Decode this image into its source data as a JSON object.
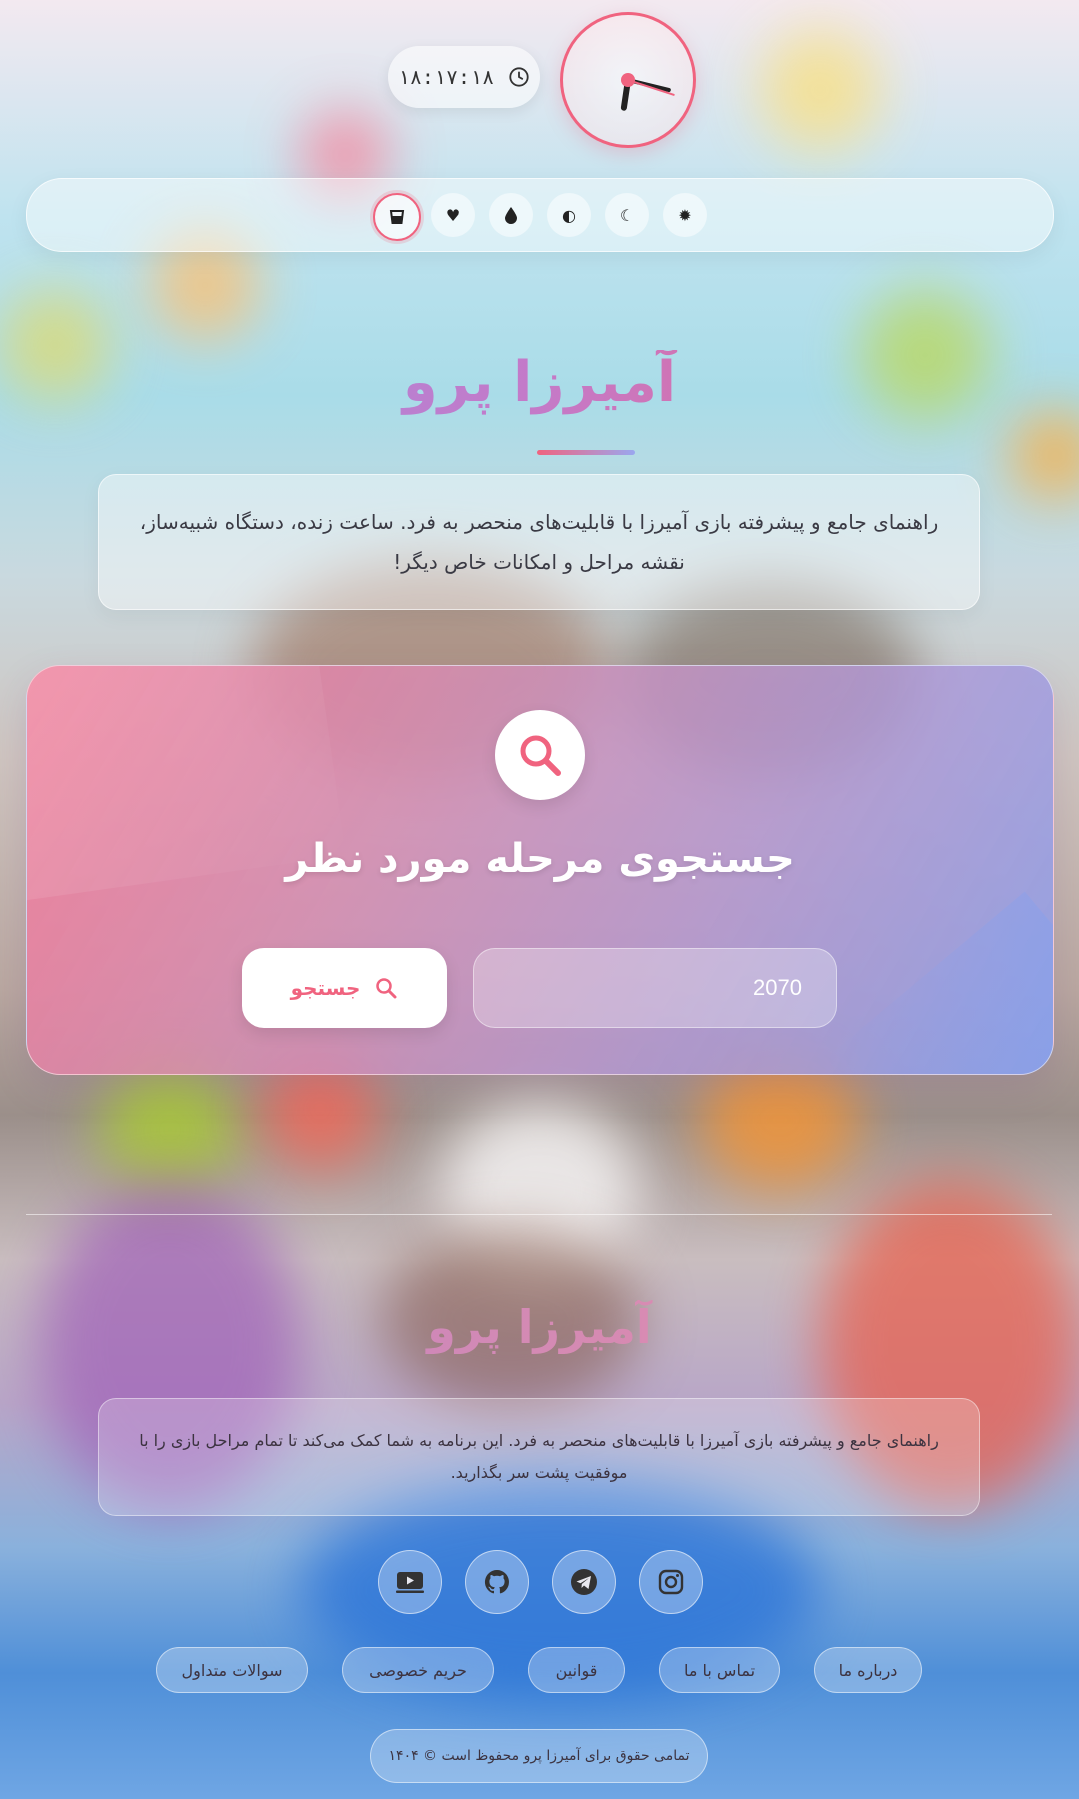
{
  "header": {
    "time": "۱۸:۱۷:۱۸",
    "clock": {
      "hour": 18,
      "minute": 17,
      "second": 18
    }
  },
  "theme_toolbar": {
    "buttons": [
      {
        "icon": "glass-icon",
        "active": true
      },
      {
        "icon": "heart-icon",
        "active": false
      },
      {
        "icon": "drop-icon",
        "active": false
      },
      {
        "icon": "contrast-icon",
        "active": false
      },
      {
        "icon": "moon-icon",
        "active": false
      },
      {
        "icon": "sun-icon",
        "active": false
      }
    ]
  },
  "hero": {
    "title": "آمیرزا پرو",
    "description": "راهنمای جامع و پیشرفته بازی آمیرزا با قابلیت‌های منحصر به فرد. ساعت زنده، دستگاه شبیه‌ساز، نقشه مراحل و امکانات خاص دیگر!"
  },
  "search": {
    "title": "جستجوی مرحله مورد نظر",
    "input_value": "2070",
    "button_label": "جستجو"
  },
  "footer": {
    "title": "آمیرزا پرو",
    "description": "راهنمای جامع و پیشرفته بازی آمیرزا با قابلیت‌های منحصر به فرد. این برنامه به شما کمک می‌کند تا تمام مراحل بازی را با موفقیت پشت سر بگذارید.",
    "social": [
      "instagram-icon",
      "telegram-icon",
      "github-icon",
      "youtube-icon"
    ],
    "links": [
      "درباره ما",
      "تماس با ما",
      "قوانین",
      "حریم خصوصی",
      "سوالات متداول"
    ],
    "copyright": "تمامی حقوق برای آمیرزا پرو محفوظ است © ۱۴۰۴"
  },
  "colors": {
    "accent": "#f0637f",
    "accent2": "#9aa7ef"
  }
}
